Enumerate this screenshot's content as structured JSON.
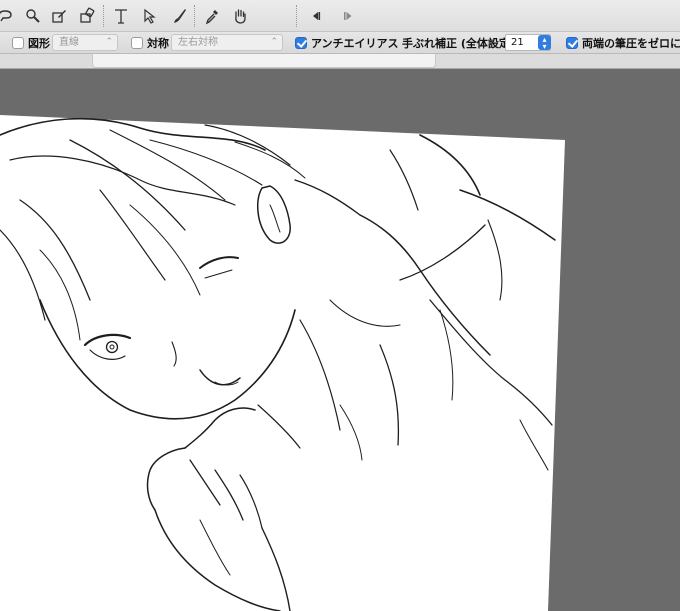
{
  "toolbar": {
    "tools": [
      {
        "name": "lasso-icon"
      },
      {
        "name": "zoom-icon"
      },
      {
        "name": "pen-icon"
      },
      {
        "name": "eraser-icon"
      },
      {
        "name": "text-tool-icon"
      },
      {
        "name": "select-arrow-icon"
      },
      {
        "name": "brush-icon"
      },
      {
        "name": "eyedropper-icon"
      },
      {
        "name": "hand-icon"
      },
      {
        "name": "previous-frame-icon"
      },
      {
        "name": "next-frame-icon"
      }
    ]
  },
  "options": {
    "shape_label": "図形",
    "shape_checked": false,
    "shape_value": "直線",
    "symmetry_label": "対称",
    "symmetry_checked": false,
    "symmetry_value": "左右対称",
    "antialias_label": "アンチエイリアス",
    "antialias_checked": true,
    "stabilizer_label": "手ぶれ補正 (全体設定)",
    "stabilizer_value": "21",
    "pressure_label": "両端の筆圧をゼロにする",
    "pressure_checked": true
  },
  "colors": {
    "workspace": "#6b6b6b",
    "accent": "#2f7de1",
    "canvas": "#ffffff"
  }
}
